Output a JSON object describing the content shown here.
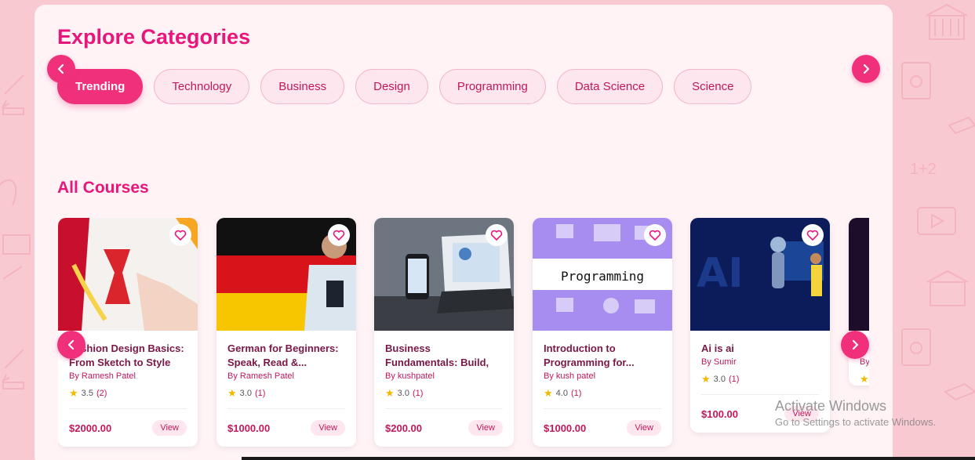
{
  "explore": {
    "title": "Explore Categories",
    "categories": [
      {
        "label": "Trending",
        "active": true
      },
      {
        "label": "Technology"
      },
      {
        "label": "Business"
      },
      {
        "label": "Design"
      },
      {
        "label": "Programming"
      },
      {
        "label": "Data Science"
      },
      {
        "label": "Science"
      }
    ]
  },
  "courses": {
    "title": "All Courses",
    "view_label": "View",
    "items": [
      {
        "title": "Fashion Design Basics: From Sketch to Style",
        "author": "By Ramesh Patel",
        "rating": "3.5",
        "count": "(2)",
        "price": "$2000.00",
        "thumb": "fashion"
      },
      {
        "title": "German for Beginners: Speak, Read &...",
        "author": "By Ramesh Patel",
        "rating": "3.0",
        "count": "(1)",
        "price": "$1000.00",
        "thumb": "german"
      },
      {
        "title": "Business Fundamentals: Build, Grow & Succeed",
        "author": "By kushpatel",
        "rating": "3.0",
        "count": "(1)",
        "price": "$200.00",
        "thumb": "business"
      },
      {
        "title": "Introduction to Programming for...",
        "author": "By kush patel",
        "rating": "4.0",
        "count": "(1)",
        "price": "$1000.00",
        "thumb": "programming",
        "thumb_text": "Programming"
      },
      {
        "title": "Ai is ai",
        "author": "By Sumir",
        "rating": "3.0",
        "count": "(1)",
        "price": "$100.00",
        "thumb": "ai",
        "thumb_text": "AI"
      },
      {
        "title": "",
        "author": "By",
        "rating": "",
        "count": "",
        "price": "",
        "thumb": "dark"
      }
    ]
  },
  "watermark": {
    "line1": "Activate Windows",
    "line2": "Go to Settings to activate Windows."
  },
  "colors": {
    "accent": "#f0307a",
    "heading": "#e8157a",
    "background": "#f9c9d2",
    "panel": "#fff3f6"
  }
}
